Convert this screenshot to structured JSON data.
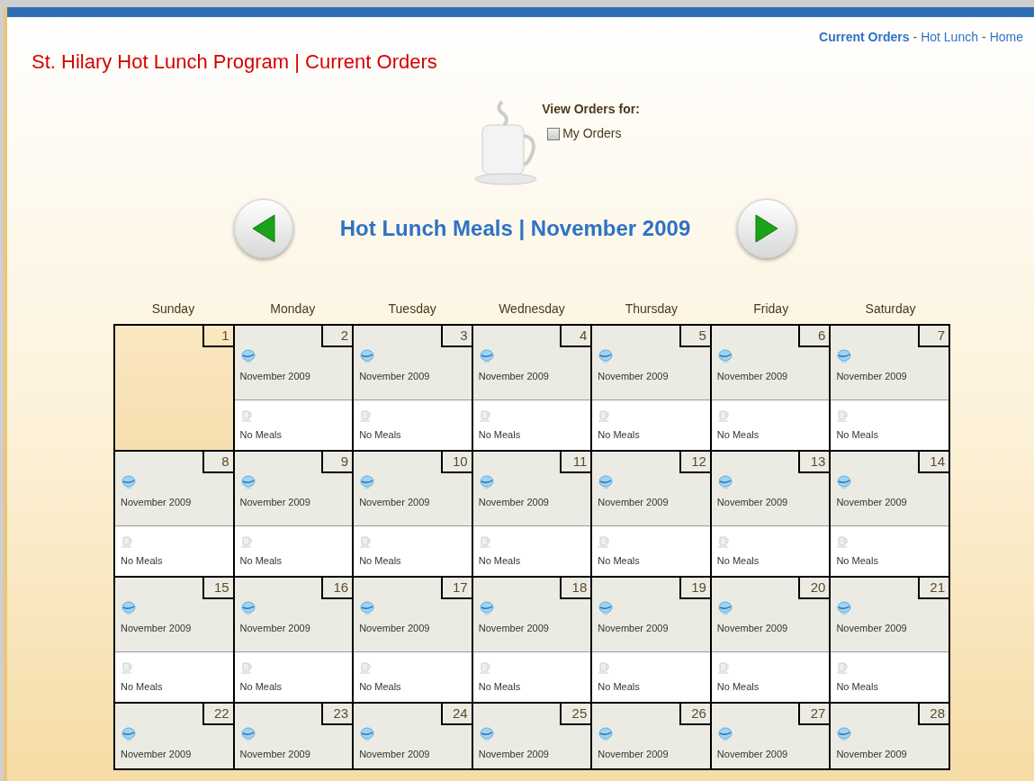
{
  "title": "St. Hilary Hot Lunch Program | Current Orders",
  "nav_links": [
    {
      "label": "Current Orders",
      "selected": true
    },
    {
      "label": "Hot Lunch",
      "selected": false
    },
    {
      "label": "Home",
      "selected": false
    }
  ],
  "nav_separator": [
    "-",
    "-"
  ],
  "view_orders": {
    "label": "View Orders for:",
    "checkbox": {
      "label": "My Orders",
      "checked": false
    }
  },
  "calendar": {
    "heading": "Hot Lunch Meals | November 2009",
    "weekdays": [
      "Sunday",
      "Monday",
      "Tuesday",
      "Wednesday",
      "Thursday",
      "Friday",
      "Saturday"
    ],
    "weeks": [
      [
        {
          "day": "1",
          "kind": "empty"
        },
        {
          "day": "2",
          "kind": "meal",
          "top": "November 2009",
          "bottom": "No Meals"
        },
        {
          "day": "3",
          "kind": "meal",
          "top": "November 2009",
          "bottom": "No Meals"
        },
        {
          "day": "4",
          "kind": "meal",
          "top": "November 2009",
          "bottom": "No Meals"
        },
        {
          "day": "5",
          "kind": "meal",
          "top": "November 2009",
          "bottom": "No Meals"
        },
        {
          "day": "6",
          "kind": "meal",
          "top": "November 2009",
          "bottom": "No Meals"
        },
        {
          "day": "7",
          "kind": "meal",
          "top": "November 2009",
          "bottom": "No Meals"
        }
      ],
      [
        {
          "day": "8",
          "kind": "meal",
          "top": "November 2009",
          "bottom": "No Meals"
        },
        {
          "day": "9",
          "kind": "meal",
          "top": "November 2009",
          "bottom": "No Meals"
        },
        {
          "day": "10",
          "kind": "meal",
          "top": "November 2009",
          "bottom": "No Meals"
        },
        {
          "day": "11",
          "kind": "meal",
          "top": "November 2009",
          "bottom": "No Meals"
        },
        {
          "day": "12",
          "kind": "meal",
          "top": "November 2009",
          "bottom": "No Meals"
        },
        {
          "day": "13",
          "kind": "meal",
          "top": "November 2009",
          "bottom": "No Meals"
        },
        {
          "day": "14",
          "kind": "meal",
          "top": "November 2009",
          "bottom": "No Meals"
        }
      ],
      [
        {
          "day": "15",
          "kind": "meal",
          "top": "November 2009",
          "bottom": "No Meals"
        },
        {
          "day": "16",
          "kind": "meal",
          "top": "November 2009",
          "bottom": "No Meals"
        },
        {
          "day": "17",
          "kind": "meal",
          "top": "November 2009",
          "bottom": "No Meals"
        },
        {
          "day": "18",
          "kind": "meal",
          "top": "November 2009",
          "bottom": "No Meals"
        },
        {
          "day": "19",
          "kind": "meal",
          "top": "November 2009",
          "bottom": "No Meals"
        },
        {
          "day": "20",
          "kind": "meal",
          "top": "November 2009",
          "bottom": "No Meals"
        },
        {
          "day": "21",
          "kind": "meal",
          "top": "November 2009",
          "bottom": "No Meals"
        }
      ],
      [
        {
          "day": "22",
          "kind": "meal",
          "top": "November 2009"
        },
        {
          "day": "23",
          "kind": "meal",
          "top": "November 2009"
        },
        {
          "day": "24",
          "kind": "meal",
          "top": "November 2009"
        },
        {
          "day": "25",
          "kind": "meal",
          "top": "November 2009"
        },
        {
          "day": "26",
          "kind": "meal",
          "top": "November 2009"
        },
        {
          "day": "27",
          "kind": "meal",
          "top": "November 2009"
        },
        {
          "day": "28",
          "kind": "meal",
          "top": "November 2009"
        }
      ]
    ]
  }
}
